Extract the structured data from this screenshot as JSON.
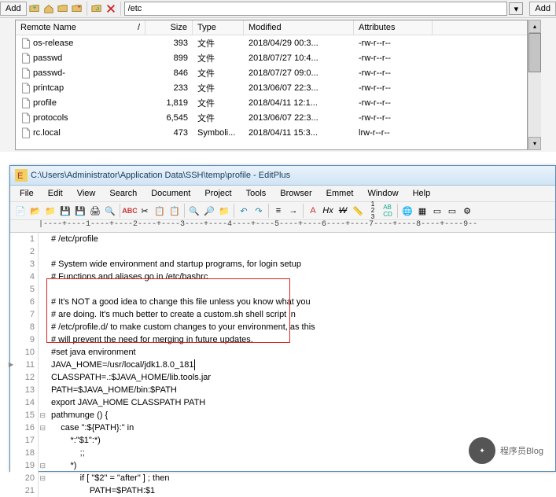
{
  "top_toolbar": {
    "add_left": "Add",
    "add_right": "Add",
    "path": "/etc"
  },
  "file_table": {
    "headers": {
      "name": "Remote Name",
      "size": "Size",
      "type": "Type",
      "modified": "Modified",
      "attributes": "Attributes"
    },
    "rows": [
      {
        "name": "os-release",
        "size": "393",
        "type": "文件",
        "modified": "2018/04/29 00:3...",
        "attr": "-rw-r--r--"
      },
      {
        "name": "passwd",
        "size": "899",
        "type": "文件",
        "modified": "2018/07/27 10:4...",
        "attr": "-rw-r--r--"
      },
      {
        "name": "passwd-",
        "size": "846",
        "type": "文件",
        "modified": "2018/07/27 09:0...",
        "attr": "-rw-r--r--"
      },
      {
        "name": "printcap",
        "size": "233",
        "type": "文件",
        "modified": "2013/06/07 22:3...",
        "attr": "-rw-r--r--"
      },
      {
        "name": "profile",
        "size": "1,819",
        "type": "文件",
        "modified": "2018/04/11 12:1...",
        "attr": "-rw-r--r--"
      },
      {
        "name": "protocols",
        "size": "6,545",
        "type": "文件",
        "modified": "2013/06/07 22:3...",
        "attr": "-rw-r--r--"
      },
      {
        "name": "rc.local",
        "size": "473",
        "type": "Symboli...",
        "modified": "2018/04/11 15:3...",
        "attr": "lrw-r--r--"
      }
    ]
  },
  "editor": {
    "title": "C:\\Users\\Administrator\\Application Data\\SSH\\temp\\profile - EditPlus",
    "menu": [
      "File",
      "Edit",
      "View",
      "Search",
      "Document",
      "Project",
      "Tools",
      "Browser",
      "Emmet",
      "Window",
      "Help"
    ],
    "ruler": "|----+----1----+----2----+----3----+----4----+----5----+----6----+----7----+----8----+----9--",
    "lines": [
      "# /etc/profile",
      "",
      "# System wide environment and startup programs, for login setup",
      "# Functions and aliases go in /etc/bashrc",
      "",
      "# It's NOT a good idea to change this file unless you know what you",
      "# are doing. It's much better to create a custom.sh shell script in",
      "# /etc/profile.d/ to make custom changes to your environment, as this",
      "# will prevent the need for merging in future updates.",
      "#set java environment",
      "JAVA_HOME=/usr/local/jdk1.8.0_181",
      "CLASSPATH=.:$JAVA_HOME/lib.tools.jar",
      "PATH=$JAVA_HOME/bin:$PATH",
      "export JAVA_HOME CLASSPATH PATH",
      "pathmunge () {",
      "    case \":${PATH}:\" in",
      "        *:\"$1\":*)",
      "            ;;",
      "        *)",
      "            if [ \"$2\" = \"after\" ] ; then",
      "                PATH=$PATH:$1"
    ]
  },
  "watermark": {
    "label": "程序员Blog"
  }
}
